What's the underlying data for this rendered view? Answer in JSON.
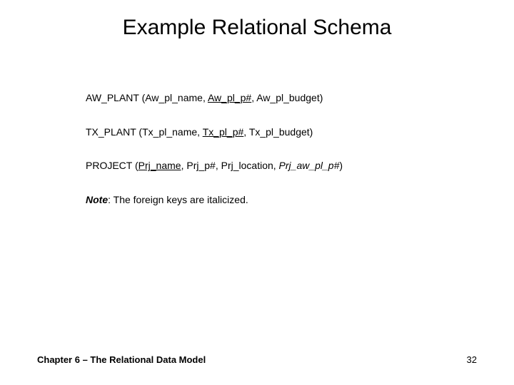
{
  "title": "Example Relational Schema",
  "relations": [
    {
      "name": "AW_PLANT",
      "attrs": [
        {
          "text": "Aw_pl_name",
          "key": false,
          "fk": false
        },
        {
          "text": "Aw_pl_p#",
          "key": true,
          "fk": false
        },
        {
          "text": "Aw_pl_budget",
          "key": false,
          "fk": false
        }
      ]
    },
    {
      "name": "TX_PLANT",
      "attrs": [
        {
          "text": "Tx_pl_name",
          "key": false,
          "fk": false
        },
        {
          "text": "Tx_pl_p#",
          "key": true,
          "fk": false
        },
        {
          "text": "Tx_pl_budget",
          "key": false,
          "fk": false
        }
      ]
    },
    {
      "name": "PROJECT",
      "attrs": [
        {
          "text": "Prj_name",
          "key": true,
          "fk": false
        },
        {
          "text": "Prj_p#",
          "key": false,
          "fk": false
        },
        {
          "text": "Prj_location",
          "key": false,
          "fk": false
        },
        {
          "text": "Prj_aw_pl_p#",
          "key": false,
          "fk": true
        }
      ]
    }
  ],
  "note": {
    "label": "Note",
    "text": ": The foreign keys are italicized."
  },
  "footer": {
    "left": "Chapter 6 – The Relational Data Model",
    "right": "32"
  }
}
